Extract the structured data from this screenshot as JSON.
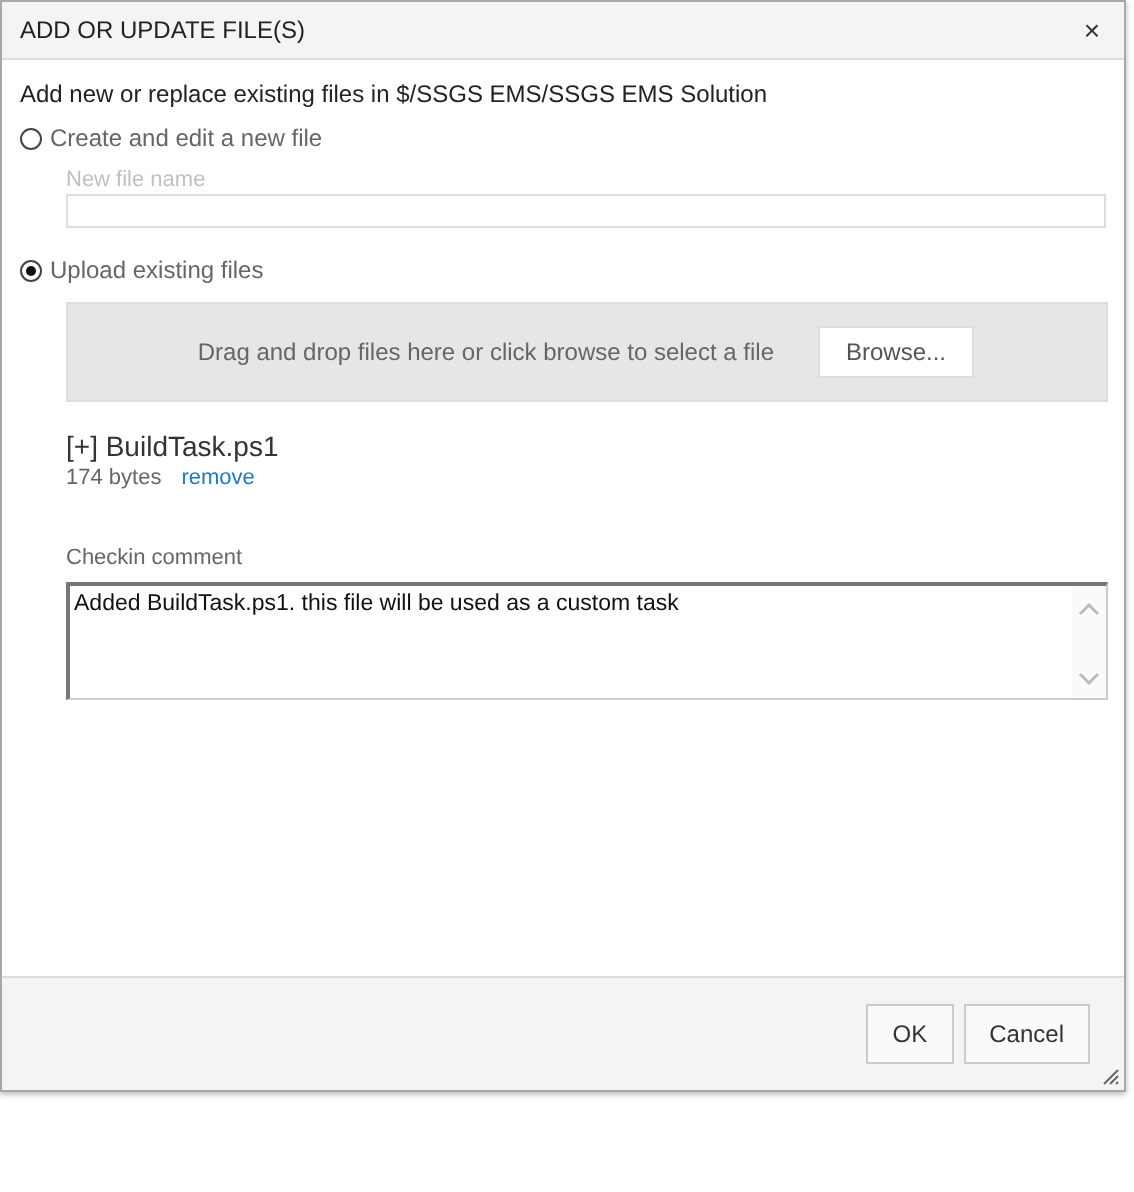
{
  "window": {
    "title": "ADD OR UPDATE FILE(S)",
    "close": "×"
  },
  "description": "Add new or replace existing files in $/SSGS EMS/SSGS EMS Solution",
  "options": [
    {
      "label": "Create and edit a new file",
      "selected": false
    },
    {
      "label": "Upload existing files",
      "selected": true
    }
  ],
  "new_file": {
    "label": "New file name",
    "disabled": true
  },
  "drop_zone": {
    "text": "Drag and drop files here or click browse to select a file",
    "button": "Browse..."
  },
  "files": [
    {
      "name": "[+] BuildTask.ps1",
      "size": "174 bytes",
      "remove": "remove"
    }
  ],
  "comment": {
    "label": "Checkin comment",
    "value": "Added BuildTask.ps1. this file will be used as a custom task"
  },
  "buttons": [
    "OK",
    "Cancel"
  ]
}
